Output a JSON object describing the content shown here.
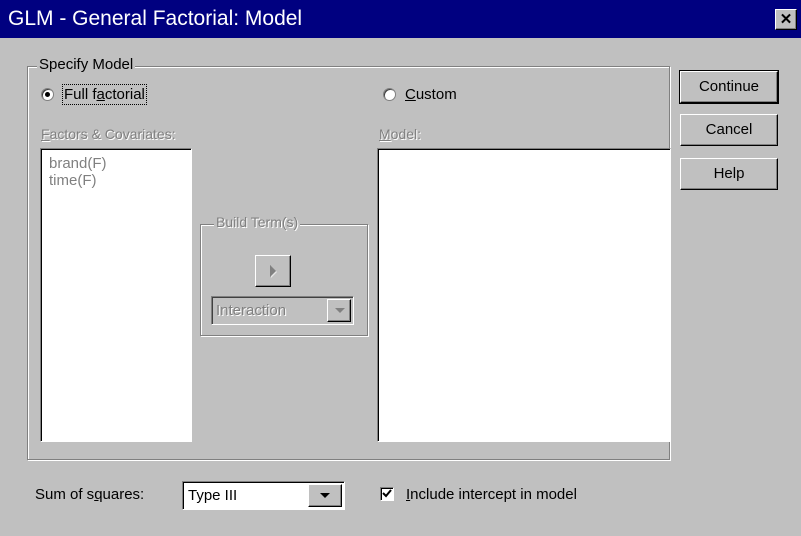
{
  "window": {
    "title": "GLM - General Factorial: Model",
    "close_label": "✕"
  },
  "specify_model": {
    "legend": "Specify Model",
    "full_factorial": {
      "label_ul": "Full f",
      "label_u": "a",
      "label_rest": "ctorial",
      "selected": true
    },
    "custom": {
      "label_u": "C",
      "label_rest": "ustom",
      "selected": false
    }
  },
  "factors": {
    "label_u": "F",
    "label_rest": "actors & Covariates:",
    "items": [
      "brand(F)",
      "time(F)"
    ]
  },
  "model": {
    "label_u": "M",
    "label_rest": "odel:"
  },
  "build_terms": {
    "legend": "Build Term(s)",
    "arrow_icon": "right-arrow-icon",
    "dropdown_value": "Interaction"
  },
  "buttons": {
    "continue": "Continue",
    "cancel": "Cancel",
    "help": "Help"
  },
  "bottom": {
    "sum_label_a": "Sum of s",
    "sum_label_u": "q",
    "sum_label_b": "uares:",
    "sum_value": "Type III",
    "include_u": "I",
    "include_rest": "nclude intercept in model",
    "include_checked": true
  },
  "colors": {
    "title_bar": "#000080",
    "face": "#c0c0c0",
    "disabled_text": "#808080"
  }
}
